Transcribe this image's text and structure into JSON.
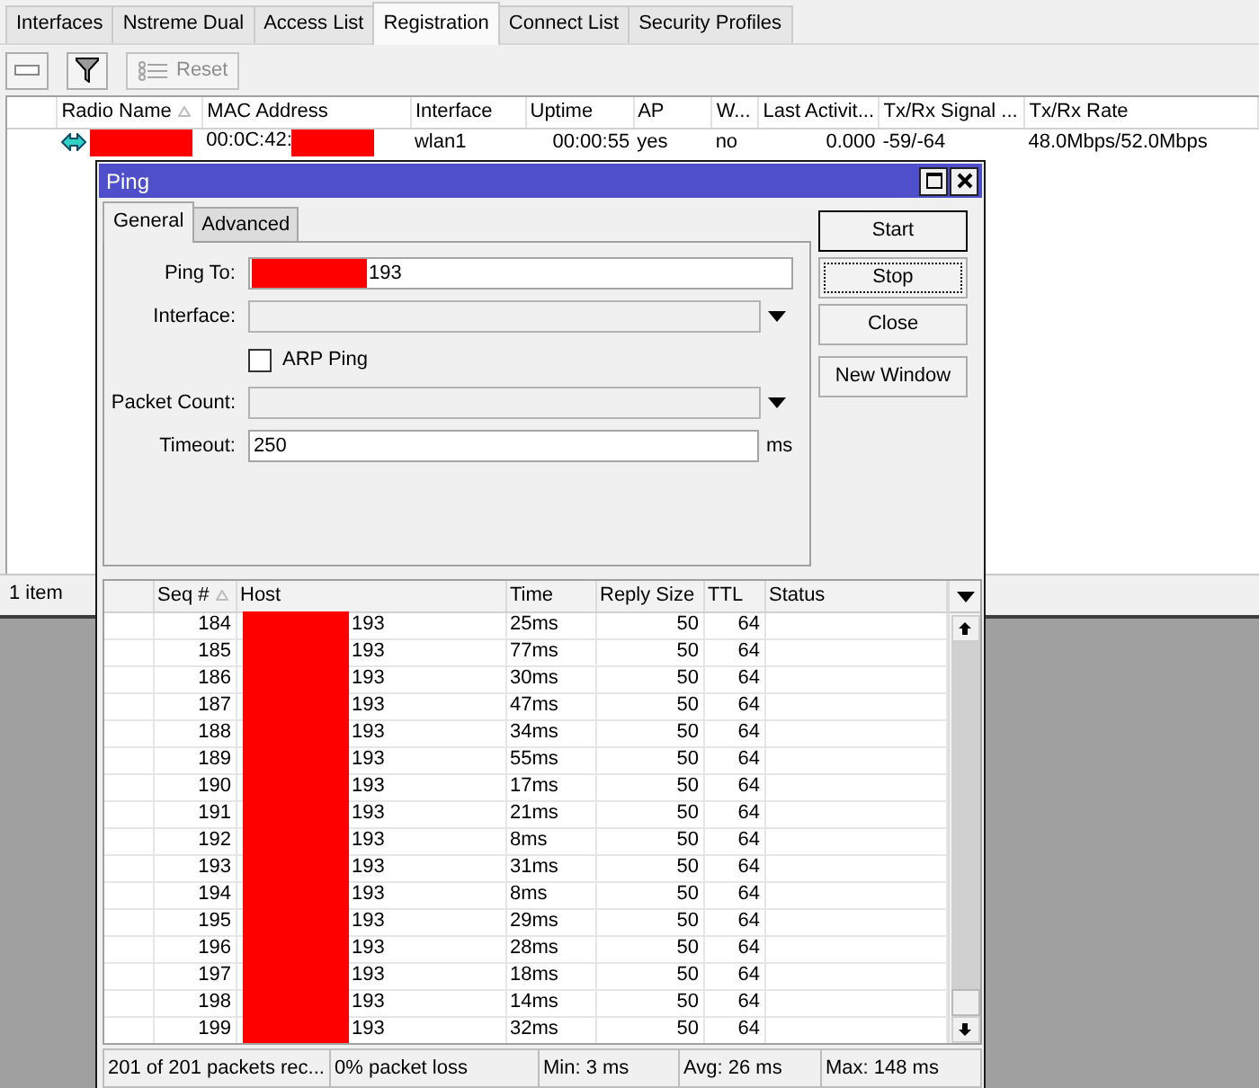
{
  "main_window": {
    "tabs": [
      {
        "label": "Interfaces",
        "selected": false
      },
      {
        "label": "Nstreme Dual",
        "selected": false
      },
      {
        "label": "Access List",
        "selected": false
      },
      {
        "label": "Registration",
        "selected": true
      },
      {
        "label": "Connect List",
        "selected": false
      },
      {
        "label": "Security Profiles",
        "selected": false
      }
    ],
    "toolbar": [
      {
        "kind": "remove",
        "disabled": false
      },
      {
        "kind": "filter",
        "disabled": false
      },
      {
        "kind": "reset",
        "label": "Reset",
        "disabled": true
      }
    ],
    "table": {
      "columns": [
        {
          "label": "Radio Name",
          "sorted": true,
          "kind": "text"
        },
        {
          "label": "MAC Address",
          "sorted": false,
          "kind": "text"
        },
        {
          "label": "Interface",
          "sorted": false,
          "kind": "text"
        },
        {
          "label": "Uptime",
          "sorted": false,
          "kind": "number"
        },
        {
          "label": "AP",
          "sorted": false,
          "kind": "text"
        },
        {
          "label": "W...",
          "sorted": false,
          "kind": "text"
        },
        {
          "label": "Last Activit...",
          "sorted": false,
          "kind": "number"
        },
        {
          "label": "Tx/Rx Signal ...",
          "sorted": false,
          "kind": "text"
        },
        {
          "label": "Tx/Rx Rate",
          "sorted": false,
          "kind": "text"
        }
      ],
      "rows": [
        {
          "cells": [
            {
              "redacted_after": true
            },
            {
              "text": "00:0C:42:",
              "redacted_after": true
            },
            {
              "text": "wlan1",
              "redacted_after": false
            },
            {
              "text": "00:00:55",
              "redacted_after": false
            },
            {
              "text": "yes",
              "redacted_after": false
            },
            {
              "text": "no",
              "redacted_after": false
            },
            {
              "text": "0.000",
              "redacted_after": false
            },
            {
              "text": "-59/-64",
              "redacted_after": false
            },
            {
              "text": "48.0Mbps/52.0Mbps",
              "redacted_after": false
            }
          ]
        }
      ]
    },
    "status_bar": "1 item"
  },
  "ping_window": {
    "title": "Ping",
    "tabs": [
      {
        "label": "General",
        "selected": true
      },
      {
        "label": "Advanced",
        "selected": false
      }
    ],
    "fields": [
      {
        "kind": "text",
        "label": "Ping To:",
        "value": "193",
        "redacted_before": true
      },
      {
        "kind": "dropdown",
        "label": "Interface:"
      },
      {
        "kind": "checkbox",
        "label": "ARP Ping",
        "checked": false
      },
      {
        "kind": "dropdown",
        "label": "Packet Count:"
      },
      {
        "kind": "text",
        "label": "Timeout:",
        "value": "250",
        "unit": "ms",
        "redacted_before": false
      }
    ],
    "buttons": [
      {
        "label": "Start",
        "default": true,
        "focused": false
      },
      {
        "label": "Stop",
        "default": false,
        "focused": true
      },
      {
        "label": "Close",
        "default": false,
        "focused": false
      },
      {
        "label": "New Window",
        "default": false,
        "focused": false
      }
    ],
    "results": {
      "columns": [
        {
          "label": "Seq #",
          "sorted": true,
          "kind": "number",
          "redacted_before": false
        },
        {
          "label": "Host",
          "sorted": false,
          "kind": "text",
          "redacted_before": true
        },
        {
          "label": "Time",
          "sorted": false,
          "kind": "text",
          "redacted_before": false
        },
        {
          "label": "Reply Size",
          "sorted": false,
          "kind": "number",
          "redacted_before": false
        },
        {
          "label": "TTL",
          "sorted": false,
          "kind": "number",
          "redacted_before": false
        },
        {
          "label": "Status",
          "sorted": false,
          "kind": "text",
          "redacted_before": false
        }
      ],
      "rows": [
        [
          "184",
          "193",
          "25ms",
          "50",
          "64"
        ],
        [
          "185",
          "193",
          "77ms",
          "50",
          "64"
        ],
        [
          "186",
          "193",
          "30ms",
          "50",
          "64"
        ],
        [
          "187",
          "193",
          "47ms",
          "50",
          "64"
        ],
        [
          "188",
          "193",
          "34ms",
          "50",
          "64"
        ],
        [
          "189",
          "193",
          "55ms",
          "50",
          "64"
        ],
        [
          "190",
          "193",
          "17ms",
          "50",
          "64"
        ],
        [
          "191",
          "193",
          "21ms",
          "50",
          "64"
        ],
        [
          "192",
          "193",
          "8ms",
          "50",
          "64"
        ],
        [
          "193",
          "193",
          "31ms",
          "50",
          "64"
        ],
        [
          "194",
          "193",
          "8ms",
          "50",
          "64"
        ],
        [
          "195",
          "193",
          "29ms",
          "50",
          "64"
        ],
        [
          "196",
          "193",
          "28ms",
          "50",
          "64"
        ],
        [
          "197",
          "193",
          "18ms",
          "50",
          "64"
        ],
        [
          "198",
          "193",
          "14ms",
          "50",
          "64"
        ],
        [
          "199",
          "193",
          "32ms",
          "50",
          "64"
        ]
      ]
    },
    "status_bar": [
      "201 of 201 packets rec...",
      "0% packet loss",
      "Min: 3 ms",
      "Avg: 26 ms",
      "Max: 148 ms"
    ]
  }
}
